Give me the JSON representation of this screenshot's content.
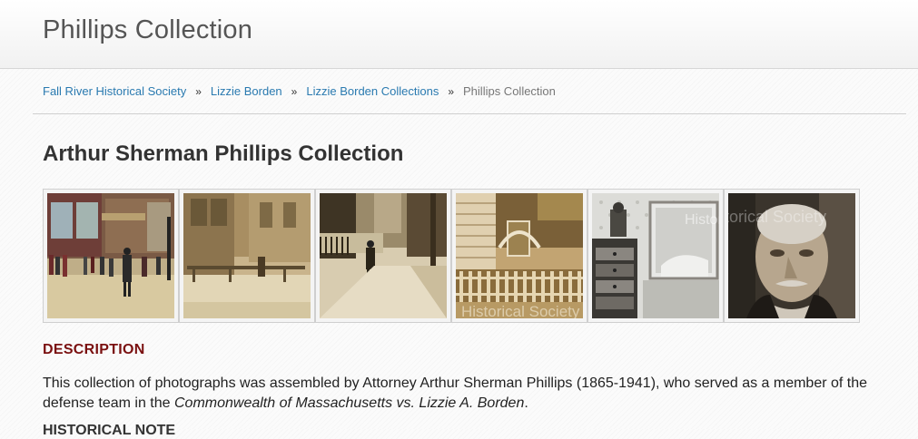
{
  "header": {
    "site_title": "Phillips Collection"
  },
  "breadcrumb": {
    "items": [
      {
        "label": "Fall River Historical Society"
      },
      {
        "label": "Lizzie Borden"
      },
      {
        "label": "Lizzie Borden Collections"
      }
    ],
    "separator": "»",
    "current": "Phillips Collection"
  },
  "page": {
    "heading": "Arthur Sherman Phillips Collection",
    "description_label": "DESCRIPTION",
    "description": {
      "text_before": "This collection of photographs was assembled by Attorney Arthur Sherman Phillips (1865-1941), who served as a member of the defense team in the ",
      "italic": "Commonwealth of Massachusetts vs. Lizzie A. Borden",
      "text_after": "."
    },
    "next_section_label": "HISTORICAL NOTE"
  },
  "gallery": {
    "thumbnails": [
      {
        "icon": "colorized-street-scene-photo"
      },
      {
        "icon": "sepia-house-porch-photo"
      },
      {
        "icon": "man-on-sidewalk-photo"
      },
      {
        "icon": "house-with-arbor-photo"
      },
      {
        "icon": "bedroom-furniture-photo"
      },
      {
        "icon": "portrait-photo"
      }
    ],
    "watermark": "Historical Society"
  },
  "colors": {
    "link": "#2a7ab0",
    "section_label": "#7a1010",
    "heading": "#333333"
  }
}
